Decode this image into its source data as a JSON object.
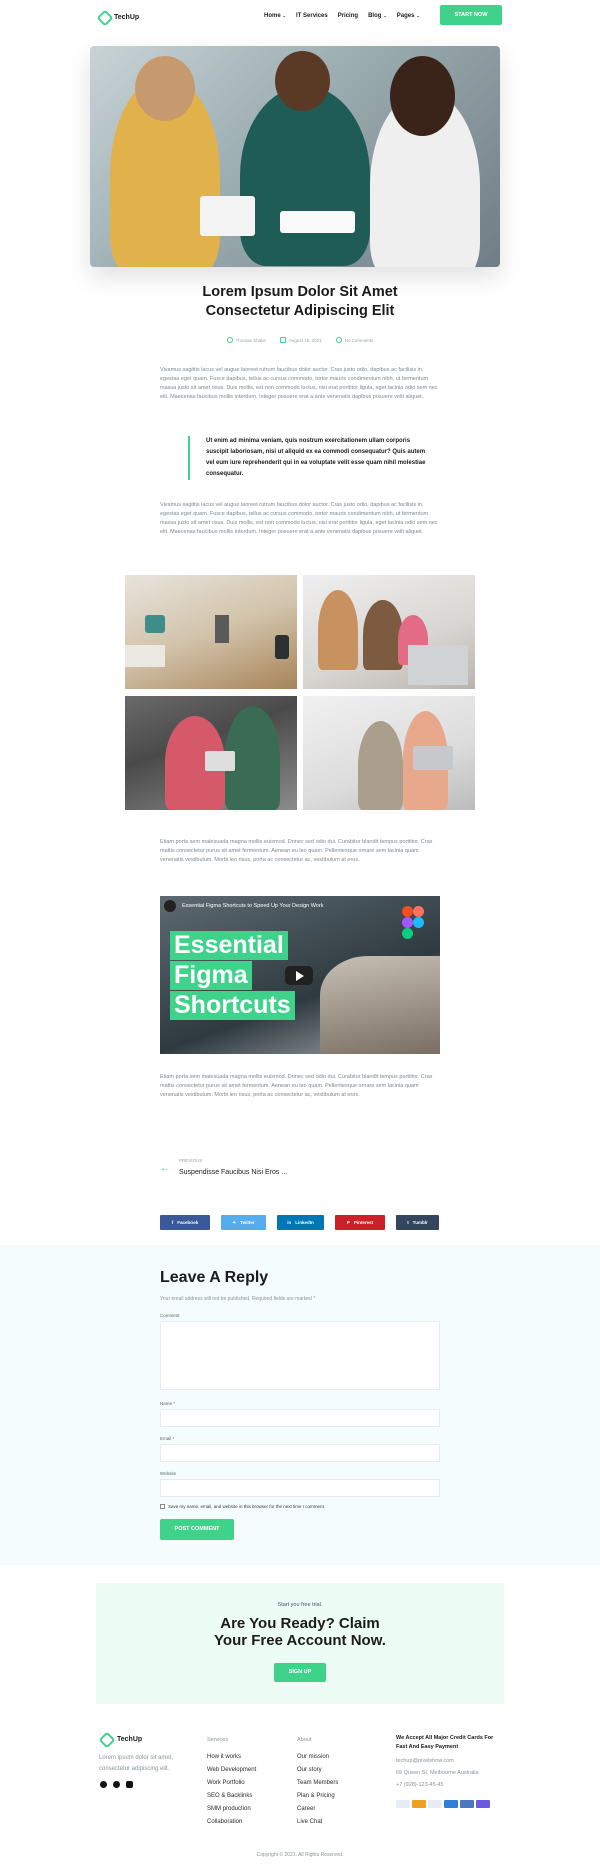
{
  "header": {
    "brand": "TechUp",
    "nav": [
      {
        "label": "Home",
        "caret": "⌄"
      },
      {
        "label": "IT Services",
        "caret": ""
      },
      {
        "label": "Pricing",
        "caret": ""
      },
      {
        "label": "Blog",
        "caret": "⌄"
      },
      {
        "label": "Pages",
        "caret": "⌄"
      }
    ],
    "cta": "START NOW"
  },
  "post": {
    "title_line1": "Lorem Ipsum Dolor Sit Amet",
    "title_line2": "Consectetur Adipiscing Elit",
    "author": "Thomas Shake",
    "date": "August 15, 2021",
    "comments": "No Comments",
    "para1": "Vivamus sagittis lacus vel augue laoreet rutrum faucibus dolor auctor. Cras justo odio, dapibus ac facilisis in, egestas eget quam. Fusce dapibus, tellus ac cursus commodo, tortor mauris condimentum nibh, ut fermentum massa justo sit amet risus. Duis mollis, est non commodo luctus, nisi erat porttitor ligula, eget lacinia odio sem nec elit. Maecenas faucibus mollis interdum. Integer posuere erat a ante venenatis dapibus posuere velit aliquet.",
    "quote": "Ut enim ad minima veniam, quis nostrum exercitationem ullam corporis suscipit laboriosam, nisi ut aliquid ex ea commodi consequatur? Quis autem vel eum iure reprehenderit qui in ea voluptate velit esse quam nihil molestiae consequatur.",
    "para2": "Vivamus sagittis lacus vel augue laoreet rutrum faucibus dolor auctor. Cras justo odio, dapibus ac facilisis in, egestas eget quam. Fusce dapibus, tellus ac cursus commodo, tortor mauris condimentum nibh, ut fermentum massa justo sit amet risus. Duis mollis, est non commodo luctus, nisi erat porttitor ligula, eget lacinia odio sem nec elit. Maecenas faucibus mollis interdum. Integer posuere erat a ante venenatis dapibus posuere velit aliquet.",
    "para3": "Etiam porta sem malesuada magna mollis euismod. Donec sed odio dui. Curabitur blandit tempus porttitor. Cras mattis consectetur purus sit amet fermentum. Aenean eu leo quam. Pellentesque ornare sem lacinia quam venenatis vestibulum. Morbi leo risus, porta ac consectetur ac, vestibulum at eros.",
    "para4": "Etiam porta sem malesuada magna mollis euismod. Donec sed odio dui. Curabitur blandit tempus porttitor. Cras mattis consectetur purus sit amet fermentum. Aenean eu leo quam. Pellentesque ornare sem lacinia quam venenatis vestibulum. Morbi leo risus, porta ac consectetur ac, vestibulum at eros."
  },
  "video": {
    "title": "Essential Figma Shortcuts to Speed Up Your Design Work",
    "line1": "Essential",
    "line2": "Figma",
    "line3": "Shortcuts"
  },
  "prev_post": {
    "label": "PREVIOUS",
    "title": "Suspendisse Faucibus Nisi Eros ..."
  },
  "share": {
    "facebook": "Facebook",
    "twitter": "Twitter",
    "linkedin": "LinkedIn",
    "pinterest": "Pinterest",
    "tumblr": "Tumblr"
  },
  "reply": {
    "heading": "Leave A Reply",
    "note": "Your email address will not be published. Required fields are marked *",
    "comment_label": "Comment",
    "name_label": "Name *",
    "email_label": "Email *",
    "website_label": "Website",
    "save_label": "Save my name, email, and website in this browser for the next time I comment.",
    "submit": "POST COMMENT"
  },
  "cta": {
    "kicker": "Start you free trial.",
    "line1": "Are You Ready? Claim",
    "line2": "Your Free Account Now.",
    "button": "SIGN UP"
  },
  "footer": {
    "brand": "TechUp",
    "tagline": "Lorem ipsum dolor sit amet, consectetur adipiscing elit.",
    "services_head": "Services",
    "services": [
      "How it works",
      "Web Development",
      "Work Portfolio",
      "SEO & Backlinks",
      "SMM production",
      "Collaboration"
    ],
    "about_head": "About",
    "about": [
      "Our mission",
      "Our story",
      "Team Members",
      "Plan & Pricing",
      "Career",
      "Live Chat"
    ],
    "cards_head": "We Accept All Major Credit Cards For Fast And Easy Payment",
    "email": "techup@pixelshow.com",
    "address": "69 Queen St, Melbourne Australia",
    "phone": "+7 (928)-123-45-45",
    "copyright": "Copyright © 2021. All Rights Reserved."
  },
  "colors": {
    "accent": "#3ed28a",
    "facebook": "#3b5998",
    "twitter": "#55acee",
    "linkedin": "#0077b5",
    "pinterest": "#cb2027",
    "tumblr": "#34465d"
  }
}
